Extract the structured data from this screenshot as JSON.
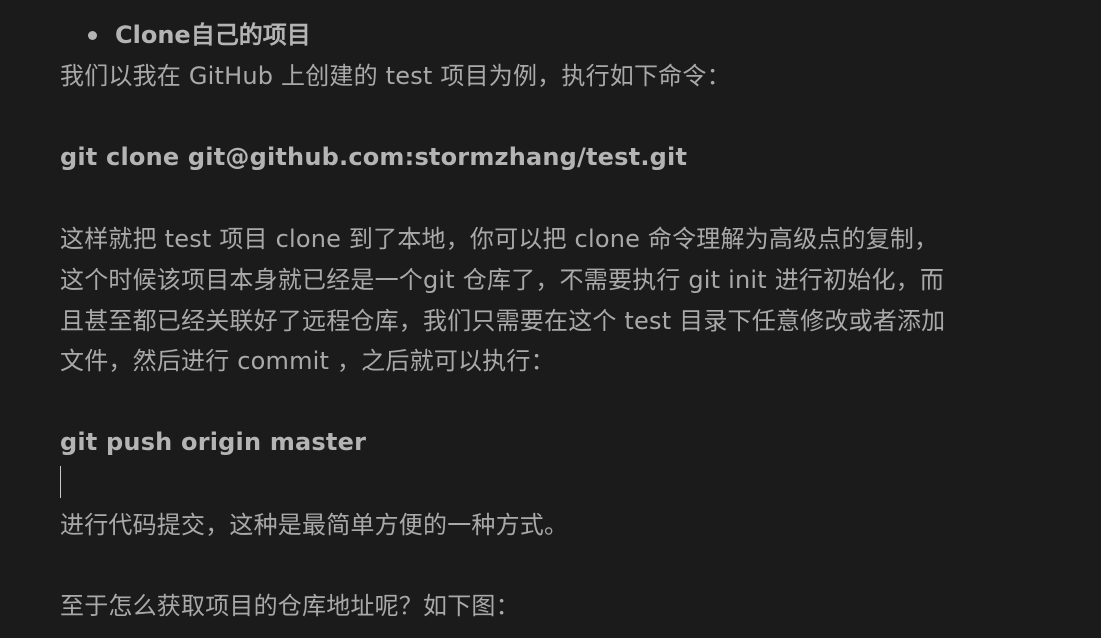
{
  "bullet": {
    "text": "Clone自己的项目"
  },
  "intro": "我们以我在 GitHub 上创建的 test 项目为例，执行如下命令：",
  "command_clone": " git clone git@github.com:stormzhang/test.git",
  "paragraph": [
    "这样就把 test 项目 clone 到了本地，你可以把 clone 命令理解为高级点的复制，",
    "这个时候该项目本身就已经是一个git 仓库了，不需要执行 git init 进行初始化，而",
    "且甚至都已经关联好了远程仓库，我们只需要在这个 test 目录下任意修改或者添加",
    "文件，然后进行 commit ，之后就可以执行："
  ],
  "command_push": "git push origin master",
  "summary": "进行代码提交，这种是最简单方便的一种方式。",
  "question": "至于怎么获取项目的仓库地址呢？如下图："
}
